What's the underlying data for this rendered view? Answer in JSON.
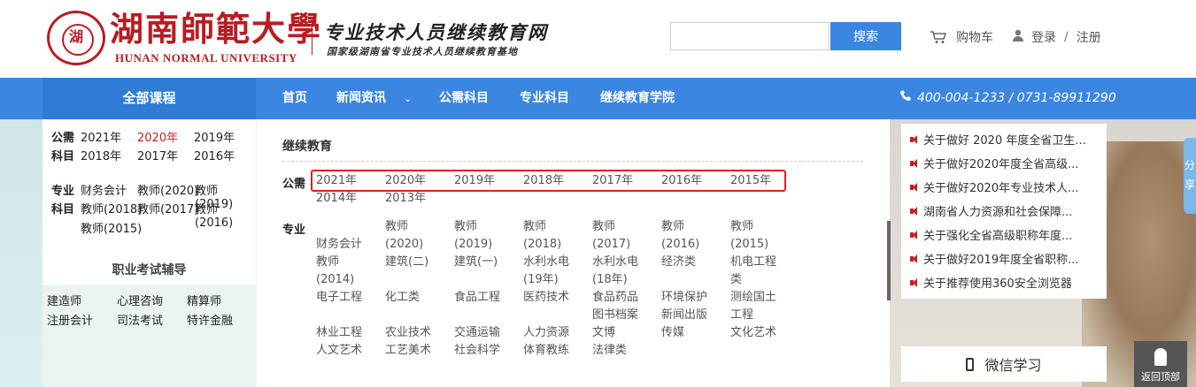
{
  "header": {
    "logo_seal_char": "湖",
    "university_cn": "湖南師範大學",
    "university_en": "HUNAN NORMAL UNIVERSITY",
    "site_name": "专业技术人员继续教育网",
    "site_subtitle": "国家级湖南省专业技术人员继续教育基地",
    "search": {
      "value": "",
      "placeholder": "",
      "button_label": "搜索"
    },
    "cart_label": "购物车",
    "login_label": "登录",
    "separator": "/",
    "register_label": "注册"
  },
  "nav": {
    "all_courses": "全部课程",
    "items": [
      "首页",
      "新闻资讯",
      "公需科目",
      "专业科目",
      "继续教育学院"
    ],
    "dropdown_arrow": "⌄",
    "phone": "400-004-1233 / 0731-89911290"
  },
  "left_panel": {
    "public_label_1": "公需",
    "public_label_2": "科目",
    "public_years": [
      "2021年",
      "2020年",
      "2019年",
      "2018年",
      "2017年",
      "2016年"
    ],
    "active_year": "2020年",
    "major_label_1": "专业",
    "major_label_2": "科目",
    "major_items": [
      "财务会计",
      "教师(2020)",
      "教师(2019)",
      "教师(2018)",
      "教师(2017)",
      "教师(2016)",
      "教师(2015)"
    ],
    "exam_title": "职业考试辅导",
    "exams": [
      "建造师",
      "心理咨询",
      "精算师",
      "注册会计",
      "司法考试",
      "特许金融"
    ]
  },
  "dropdown": {
    "title": "继续教育",
    "public_label": "公需",
    "public_years": [
      "2021年",
      "2020年",
      "2019年",
      "2018年",
      "2017年",
      "2016年",
      "2015年",
      "2014年",
      "2013年"
    ],
    "major_label": "专业",
    "major_items": [
      "财务会计",
      "教师\n(2020)",
      "教师\n(2019)",
      "教师\n(2018)",
      "教师\n(2017)",
      "教师\n(2016)",
      "教师\n(2015)",
      "教师\n(2014)",
      "建筑(二)",
      "建筑(一)",
      "水利水电\n(19年)",
      "水利水电\n(18年)",
      "经济类",
      "机电工程\n类",
      "电子工程",
      "化工类",
      "食品工程",
      "医药技术",
      "食品药品\n图书档案",
      "环境保护\n新闻出版",
      "测绘国土\n工程",
      "林业工程\n人文艺术",
      "农业技术\n工艺美术",
      "交通运输\n社会科学",
      "人力资源\n体育教练",
      "文博\n法律类",
      "传媒",
      "文化艺术"
    ]
  },
  "notices": [
    "关于做好 2020 年度全省卫生...",
    "关于做好2020年度全省高级...",
    "关于做好2020年专业技术人...",
    "湖南省人力资源和社会保障...",
    "关于强化全省高级职称年度...",
    "关于做好2019年度全省职称...",
    "关于推荐使用360安全浏览器"
  ],
  "side_tab_label": "分享",
  "weixin_label": "微信学习",
  "back_top_label": "返回顶部",
  "colors": {
    "accent": "#3b86e0",
    "brand": "#b81c22",
    "active": "#c91e1e",
    "highlight": "#e02020"
  }
}
